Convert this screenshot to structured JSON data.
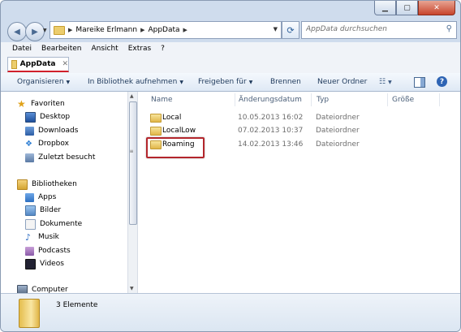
{
  "window": {
    "caption_buttons": {
      "minimize": "▁",
      "maximize": "▢",
      "close": "✕"
    }
  },
  "address": {
    "crumbs": [
      "Mareike Erlmann",
      "AppData"
    ],
    "refresh_glyph": "⟳"
  },
  "search": {
    "placeholder": "AppData durchsuchen"
  },
  "menu": [
    "Datei",
    "Bearbeiten",
    "Ansicht",
    "Extras",
    "?"
  ],
  "tab": {
    "label": "AppData",
    "close": "✕"
  },
  "toolbar": {
    "organize": "Organisieren",
    "include_library": "In Bibliothek aufnehmen",
    "share": "Freigeben für",
    "burn": "Brennen",
    "new_folder": "Neuer Ordner",
    "help": "?"
  },
  "nav": {
    "favorites": {
      "label": "Favoriten",
      "items": [
        "Desktop",
        "Downloads",
        "Dropbox",
        "Zuletzt besucht"
      ]
    },
    "libraries": {
      "label": "Bibliotheken",
      "items": [
        "Apps",
        "Bilder",
        "Dokumente",
        "Musik",
        "Podcasts",
        "Videos"
      ]
    },
    "computer": "Computer"
  },
  "columns": {
    "name": "Name",
    "date": "Änderungsdatum",
    "type": "Typ",
    "size": "Größe"
  },
  "files": [
    {
      "name": "Local",
      "date": "10.05.2013 16:02",
      "type": "Dateiordner"
    },
    {
      "name": "LocalLow",
      "date": "07.02.2013 10:37",
      "type": "Dateiordner"
    },
    {
      "name": "Roaming",
      "date": "14.02.2013 13:46",
      "type": "Dateiordner"
    }
  ],
  "status": {
    "count": "3 Elemente"
  },
  "colors": {
    "highlight": "#b3262c",
    "tab_underline": "#d0202b"
  }
}
